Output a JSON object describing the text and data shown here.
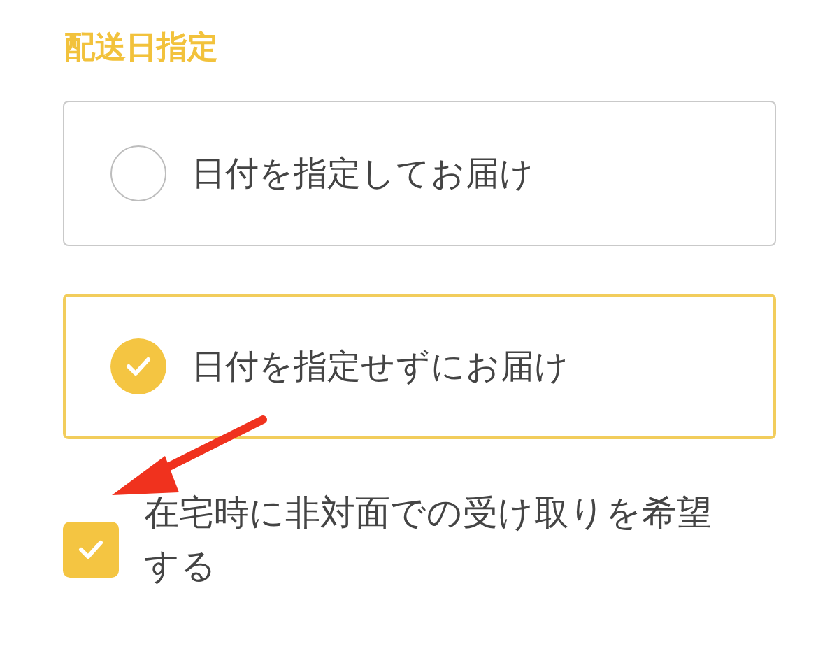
{
  "heading": "配送日指定",
  "options": [
    {
      "label": "日付を指定してお届け",
      "selected": false
    },
    {
      "label": "日付を指定せずにお届け",
      "selected": true
    }
  ],
  "checkbox": {
    "label": "在宅時に非対面での受け取りを希望する",
    "checked": true
  }
}
